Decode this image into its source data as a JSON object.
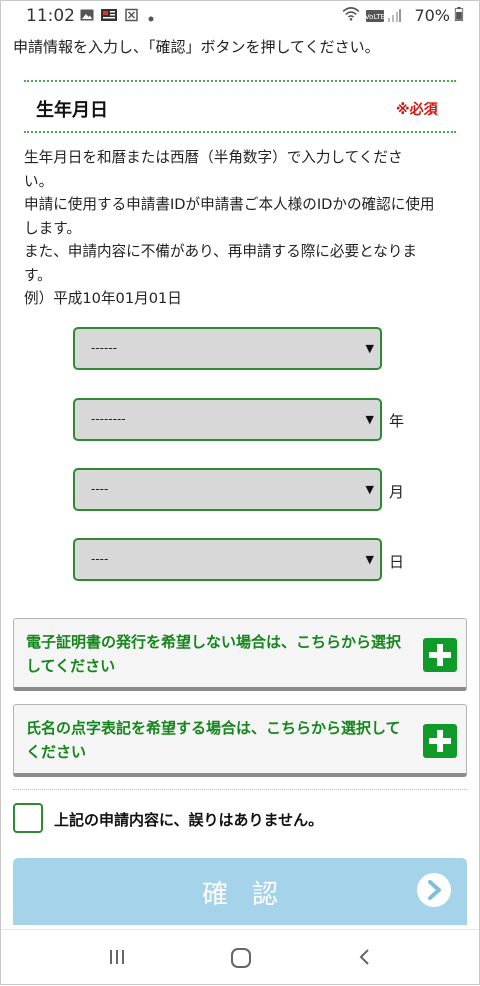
{
  "status_bar": {
    "time": "11:02",
    "battery_percent": "70%",
    "left_icons": [
      "image-icon",
      "news-app-icon",
      "notification-icon",
      "dot-icon"
    ],
    "right_icons": [
      "wifi-icon",
      "volte-icon",
      "signal-icon",
      "battery-icon"
    ]
  },
  "intro_text": "申請情報を入力し、「確認」ボタンを押してください。",
  "section": {
    "title": "生年月日",
    "required_label": "※必須",
    "required_color": "#d4140e"
  },
  "description": [
    "生年月日を和暦または西暦（半角数字）で入力してくださ",
    "い。",
    "申請に使用する申請書IDが申請書ご本人様のIDかの確認に使用",
    "します。",
    "また、申請内容に不備があり、再申請する際に必要となりま",
    "す。",
    "例）平成10年01月01日"
  ],
  "selects": [
    {
      "value": "------",
      "unit": ""
    },
    {
      "value": "--------",
      "unit": "年"
    },
    {
      "value": "----",
      "unit": "月"
    },
    {
      "value": "----",
      "unit": "日"
    }
  ],
  "expanders": [
    {
      "label": "電子証明書の発行を希望しない場合は、こちらから選択してください"
    },
    {
      "label": "氏名の点字表記を希望する場合は、こちらから選択してください"
    }
  ],
  "confirm_checkbox": {
    "label": "上記の申請内容に、誤りはありません。",
    "checked": false
  },
  "confirm_button": {
    "label": "確認",
    "disabled_color": "#a5d3ea"
  },
  "accent_color": "#2e8b34",
  "nav_bar": [
    "recent-apps-icon",
    "home-icon",
    "back-icon"
  ]
}
